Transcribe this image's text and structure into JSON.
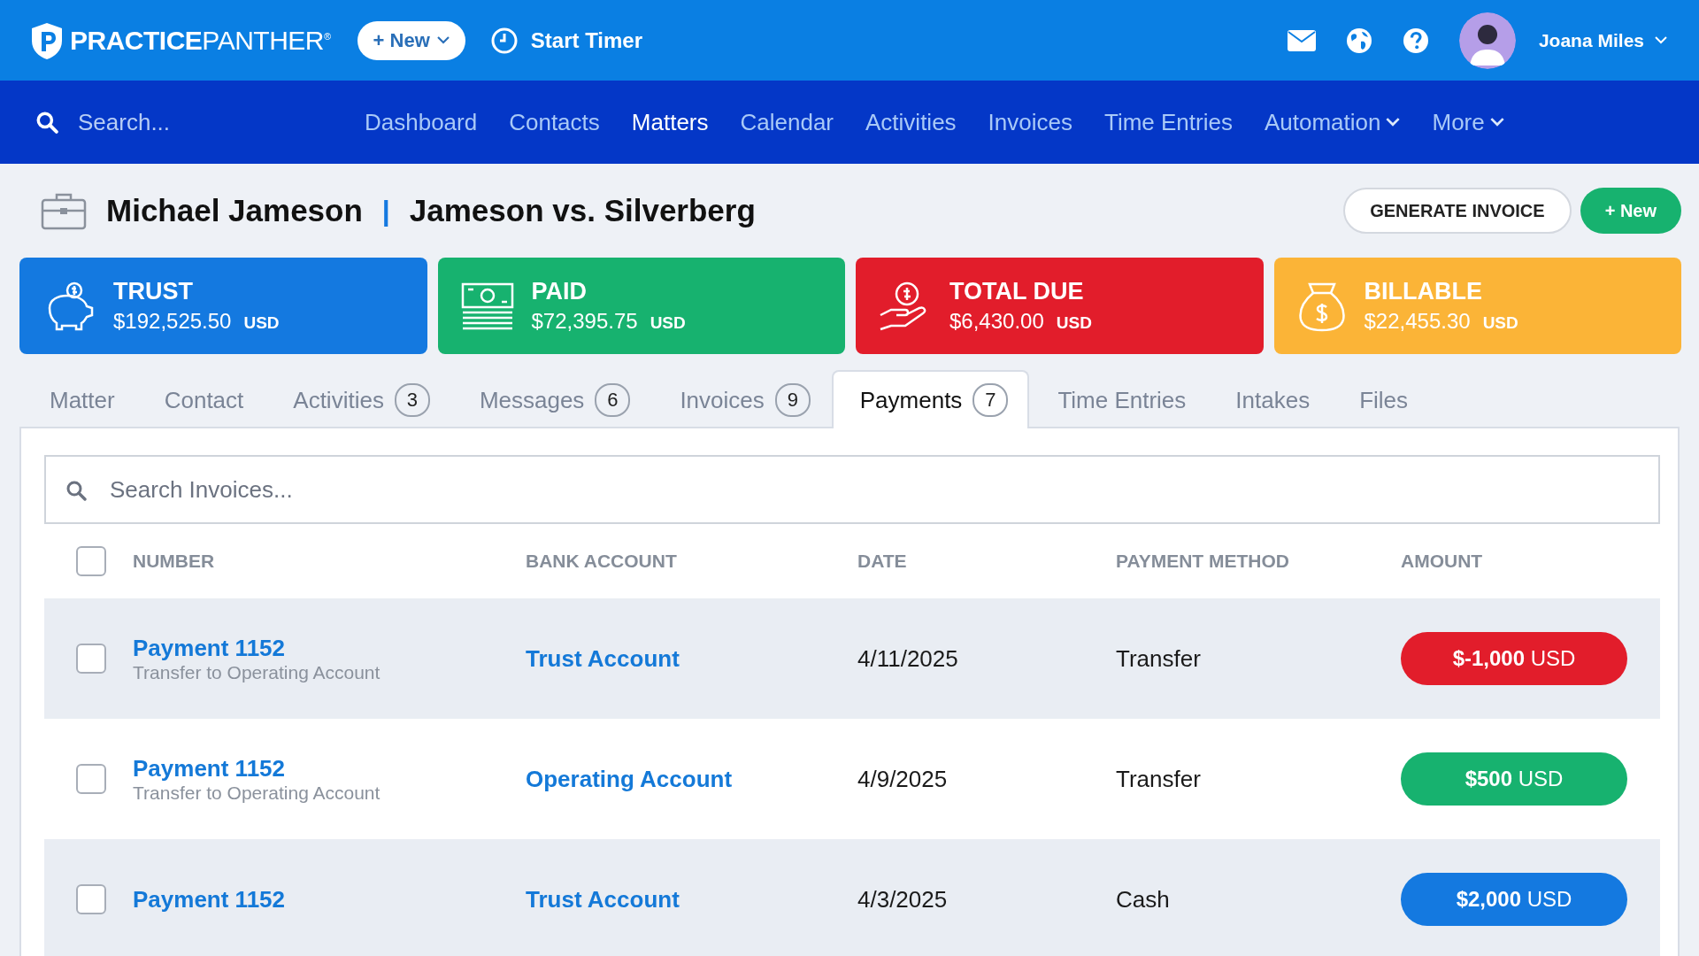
{
  "topbar": {
    "logo": {
      "bold": "PRACTICE",
      "light": "PANTHER",
      "mark": "®"
    },
    "new_button": "+ New",
    "timer": "Start Timer",
    "user": "Joana Miles"
  },
  "nav": {
    "search_placeholder": "Search...",
    "items": [
      {
        "label": "Dashboard",
        "selected": false,
        "dropdown": false
      },
      {
        "label": "Contacts",
        "selected": false,
        "dropdown": false
      },
      {
        "label": "Matters",
        "selected": true,
        "dropdown": false
      },
      {
        "label": "Calendar",
        "selected": false,
        "dropdown": false
      },
      {
        "label": "Activities",
        "selected": false,
        "dropdown": false
      },
      {
        "label": "Invoices",
        "selected": false,
        "dropdown": false
      },
      {
        "label": "Time Entries",
        "selected": false,
        "dropdown": false
      },
      {
        "label": "Automation",
        "selected": false,
        "dropdown": true
      },
      {
        "label": "More",
        "selected": false,
        "dropdown": true
      }
    ]
  },
  "header": {
    "client": "Michael Jameson",
    "separator": "|",
    "matter": "Jameson vs. Silverberg",
    "buttons": [
      {
        "label": "GENERATE INVOICE",
        "kind": "outline"
      },
      {
        "label": "+ New",
        "kind": "primary"
      }
    ]
  },
  "cards": [
    {
      "title": "TRUST",
      "amount": "$192,525.50",
      "currency": "USD",
      "color": "#1479e0",
      "kind": "piggy"
    },
    {
      "title": "PAID",
      "amount": "$72,395.75",
      "currency": "USD",
      "color": "#17b26f",
      "kind": "cash"
    },
    {
      "title": "TOTAL DUE",
      "amount": "$6,430.00",
      "currency": "USD",
      "color": "#e21d2b",
      "kind": "hand"
    },
    {
      "title": "BILLABLE",
      "amount": "$22,455.30",
      "currency": "USD",
      "color": "#fbb437",
      "kind": "bag"
    }
  ],
  "tabs": [
    {
      "label": "Matter",
      "selected": false
    },
    {
      "label": "Contact",
      "selected": false
    },
    {
      "label": "Activities",
      "count": "3",
      "selected": false
    },
    {
      "label": "Messages",
      "count": "6",
      "selected": false
    },
    {
      "label": "Invoices",
      "count": "9",
      "selected": false
    },
    {
      "label": "Payments",
      "count": "7",
      "selected": true
    },
    {
      "label": "Time Entries",
      "selected": false
    },
    {
      "label": "Intakes",
      "selected": false
    },
    {
      "label": "Files",
      "selected": false
    }
  ],
  "search": {
    "placeholder": "Search Invoices..."
  },
  "table": {
    "select_all_checked": false,
    "columns": [
      "NUMBER",
      "BANK ACCOUNT",
      "DATE",
      "PAYMENT METHOD",
      "AMOUNT"
    ],
    "rows": [
      {
        "checked": false,
        "number": "Payment 1152",
        "note": "Transfer to Operating Account",
        "bank_account": "Trust Account",
        "date": "4/11/2025",
        "method": "Transfer",
        "amount": "**$-1,000** USD",
        "color": "#e21d2b"
      },
      {
        "checked": false,
        "number": "Payment 1152",
        "note": "Transfer to Operating Account",
        "bank_account": "Operating Account",
        "date": "4/9/2025",
        "method": "Transfer",
        "amount": "**$500** USD",
        "color": "#17b26f"
      },
      {
        "checked": false,
        "number": "Payment 1152",
        "bank_account": "Trust Account",
        "date": "4/3/2025",
        "method": "Cash",
        "amount": "**$2,000** USD",
        "color": "#1479e0"
      }
    ]
  }
}
